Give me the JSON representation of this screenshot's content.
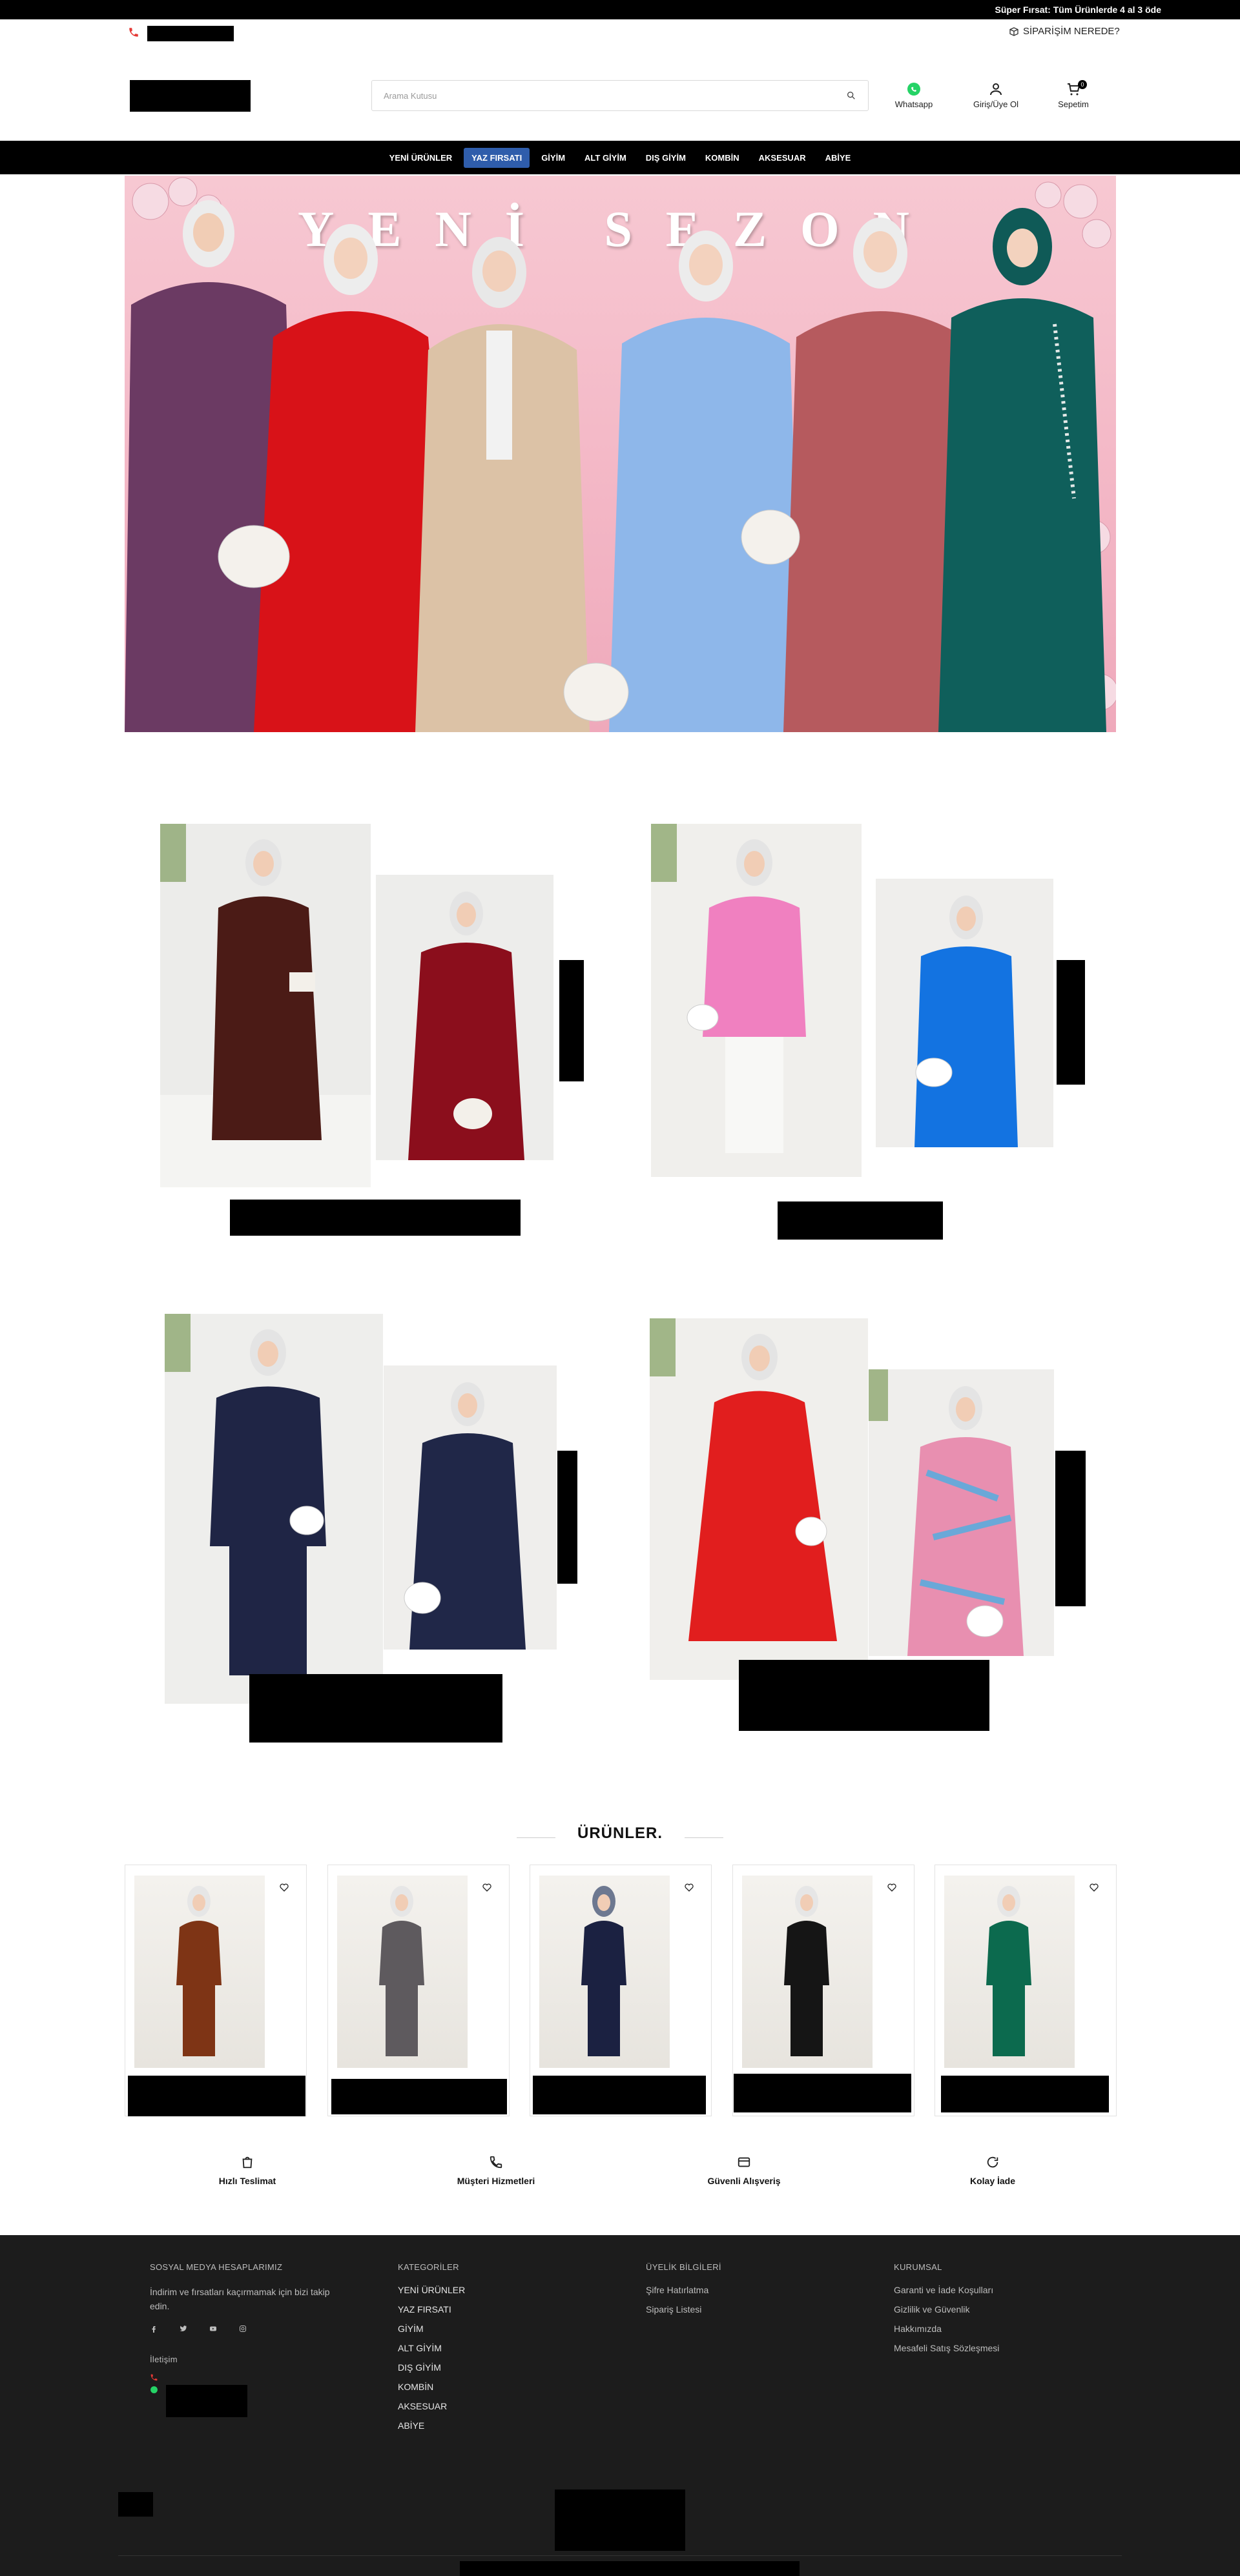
{
  "promo": {
    "text": "Süper Fırsat: Tüm Ürünlerde 4 al 3 öde"
  },
  "header": {
    "order_tracking": "SİPARİŞİM NEREDE?",
    "search_placeholder": "Arama Kutusu",
    "whatsapp_label": "Whatsapp",
    "login_label": "Giriş/Üye Ol",
    "cart_label": "Sepetim",
    "cart_count": "0"
  },
  "nav": {
    "items": [
      "YENİ ÜRÜNLER",
      "YAZ FIRSATI",
      "GİYİM",
      "ALT GİYİM",
      "DIŞ GİYİM",
      "KOMBİN",
      "AKSESUAR",
      "ABİYE"
    ],
    "active_index": 1
  },
  "hero": {
    "title": "YENİ SEZON"
  },
  "products_section": {
    "title": "ÜRÜNLER."
  },
  "features": [
    "Hızlı Teslimat",
    "Müşteri Hizmetleri",
    "Güvenli Alışveriş",
    "Kolay İade"
  ],
  "footer": {
    "social": {
      "heading": "SOSYAL MEDYA HESAPLARIMIZ",
      "text": "İndirim ve fırsatları kaçırmamak için bizi takip edin.",
      "contact_heading": "İletişim"
    },
    "categories": {
      "heading": "KATEGORİLER",
      "items": [
        "YENİ ÜRÜNLER",
        "YAZ FIRSATI",
        "GİYİM",
        "ALT GİYİM",
        "DIŞ GİYİM",
        "KOMBİN",
        "AKSESUAR",
        "ABİYE"
      ]
    },
    "membership": {
      "heading": "ÜYELİK BİLGİLERİ",
      "items": [
        "Şifre Hatırlatma",
        "Sipariş Listesi"
      ]
    },
    "corporate": {
      "heading": "KURUMSAL",
      "items": [
        "Garanti ve İade Koşulları",
        "Gizlilik ve Güvenlik",
        "Hakkımızda",
        "Mesafeli Satış Sözleşmesi"
      ]
    }
  },
  "colors": {
    "nav_bg": "#000000",
    "nav_active": "#2f5dab",
    "footer_bg": "#1c1c1c",
    "phone_red": "#e53935",
    "whatsapp_green": "#25d366"
  }
}
